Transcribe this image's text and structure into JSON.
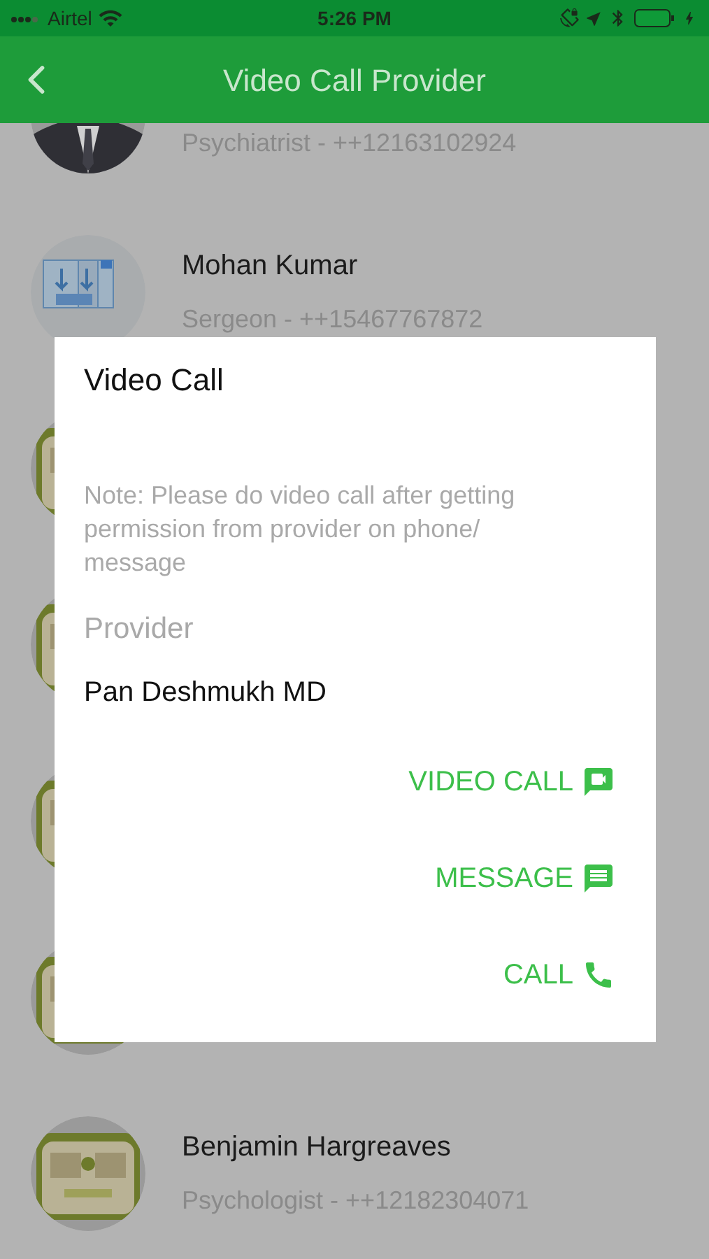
{
  "status_bar": {
    "carrier": "Airtel",
    "time": "5:26 PM"
  },
  "header": {
    "title": "Video Call Provider"
  },
  "providers": [
    {
      "kind": "picture",
      "subtitle": "Psychiatrist - ++12163102924"
    },
    {
      "kind": "picture",
      "name": "Mohan Kumar",
      "subtitle": "Sergeon - ++15467767872"
    },
    {
      "kind": "picture"
    },
    {
      "kind": "picture"
    },
    {
      "kind": "picture"
    },
    {
      "kind": "picture"
    },
    {
      "kind": "picture",
      "name": "Benjamin Hargreaves",
      "subtitle": "Psychologist - ++12182304071"
    }
  ],
  "dialog": {
    "title": "Video Call",
    "note": "Note: Please do video call after getting permission from provider on phone/ message",
    "provider_label": "Provider",
    "provider_name": "Pan Deshmukh MD",
    "actions": [
      {
        "label": "VIDEO CALL",
        "kind": "video"
      },
      {
        "label": "MESSAGE",
        "kind": "message"
      },
      {
        "label": "CALL",
        "kind": "call"
      }
    ]
  }
}
